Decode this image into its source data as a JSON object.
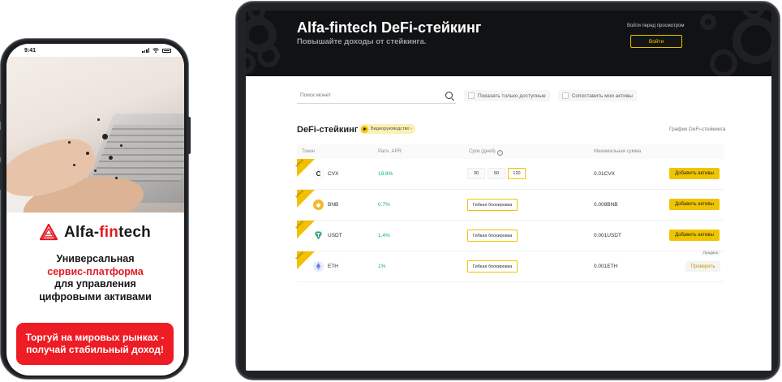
{
  "phone": {
    "time": "9:41",
    "brand_prefix": "Alfa-",
    "brand_accent": "fin",
    "brand_suffix": "tech",
    "tagline_line1": "Универсальная",
    "tagline_line2": "сервис-платформа",
    "tagline_line3": "для управления",
    "tagline_line4": "цифровыми активами",
    "cta_line1": "Торгуй на мировых рынках -",
    "cta_line2": "получай стабильный доход!"
  },
  "tablet": {
    "title": "Alfa-fintech DeFi-стейкинг",
    "subtitle": "Повышайте доходы от стейкинга.",
    "login_hint": "Войти перед просмотром",
    "login_button": "Войти",
    "search_placeholder": "Поиск монет",
    "filter_available": "Показать только доступные",
    "filter_match": "Сопоставить мои активы",
    "section_title": "DeFi-стейкинг",
    "guide_label": "Видеоруководство ›",
    "chart_link": "График DeFi-стейкинга",
    "columns": {
      "token": "Токен",
      "apr": "Расч. APR",
      "term": "Срок (дней)",
      "min": "Минимальная сумма"
    },
    "ribbon_label": "BONUS",
    "rows": [
      {
        "coin": "CVX",
        "apr": "19.8%",
        "terms": [
          "30",
          "60",
          "120"
        ],
        "min": "0.01CVX",
        "action": "Добавить активы"
      },
      {
        "coin": "BNB",
        "apr": "0.7%",
        "flexible": "Гибкая блокировка",
        "min": "0.008BNB",
        "action": "Добавить активы"
      },
      {
        "coin": "USDT",
        "apr": "1.4%",
        "flexible": "Гибкая блокировка",
        "min": "0.001USDT",
        "action": "Добавить активы"
      },
      {
        "coin": "ETH",
        "apr": "1%",
        "flexible": "Гибкая блокировка",
        "min": "0.001ETH",
        "action": "Проверить",
        "sold_tag": "Продано"
      }
    ],
    "colors": {
      "accent": "#f0c400",
      "apr_green": "#0ab07a",
      "brand_red": "#e01b22"
    }
  }
}
